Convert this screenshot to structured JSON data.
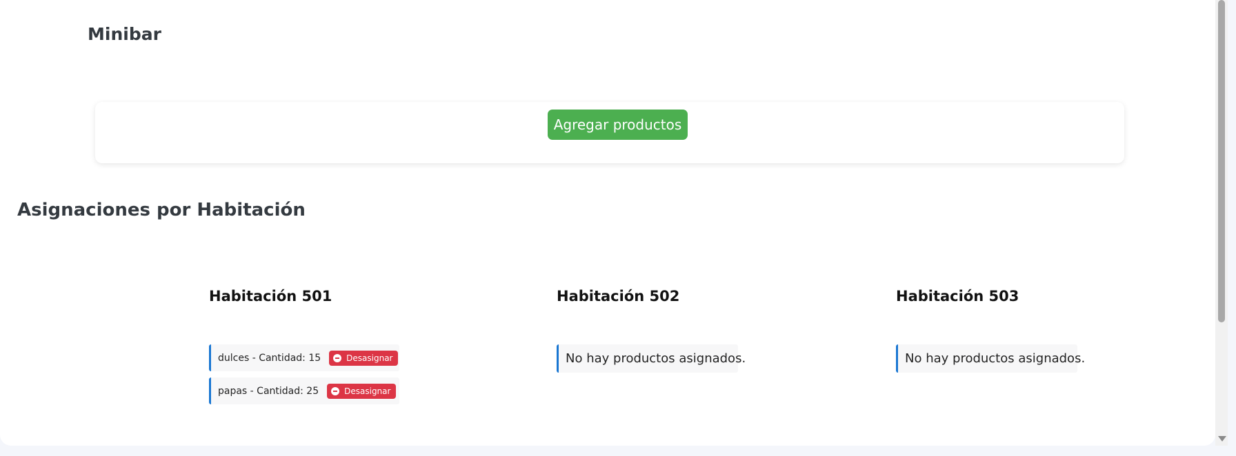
{
  "page": {
    "title": "Minibar",
    "add_button_label": "Agregar productos",
    "section_title": "Asignaciones por Habitación"
  },
  "rooms": [
    {
      "title": "Habitación 501",
      "items": [
        {
          "text": "dulces - Cantidad: 15",
          "action_label": "Desasignar"
        },
        {
          "text": "papas - Cantidad: 25",
          "action_label": "Desasignar"
        }
      ]
    },
    {
      "title": "Habitación 502",
      "empty_text": "No hay productos asignados."
    },
    {
      "title": "Habitación 503",
      "empty_text": "No hay productos asignados."
    }
  ],
  "colors": {
    "add_button": "#4caf50",
    "remove_button": "#dc3545",
    "item_accent": "#1976d2"
  },
  "icons": {
    "remove": "minus-circle-icon",
    "scroll_down": "scroll-down-arrow-icon"
  }
}
